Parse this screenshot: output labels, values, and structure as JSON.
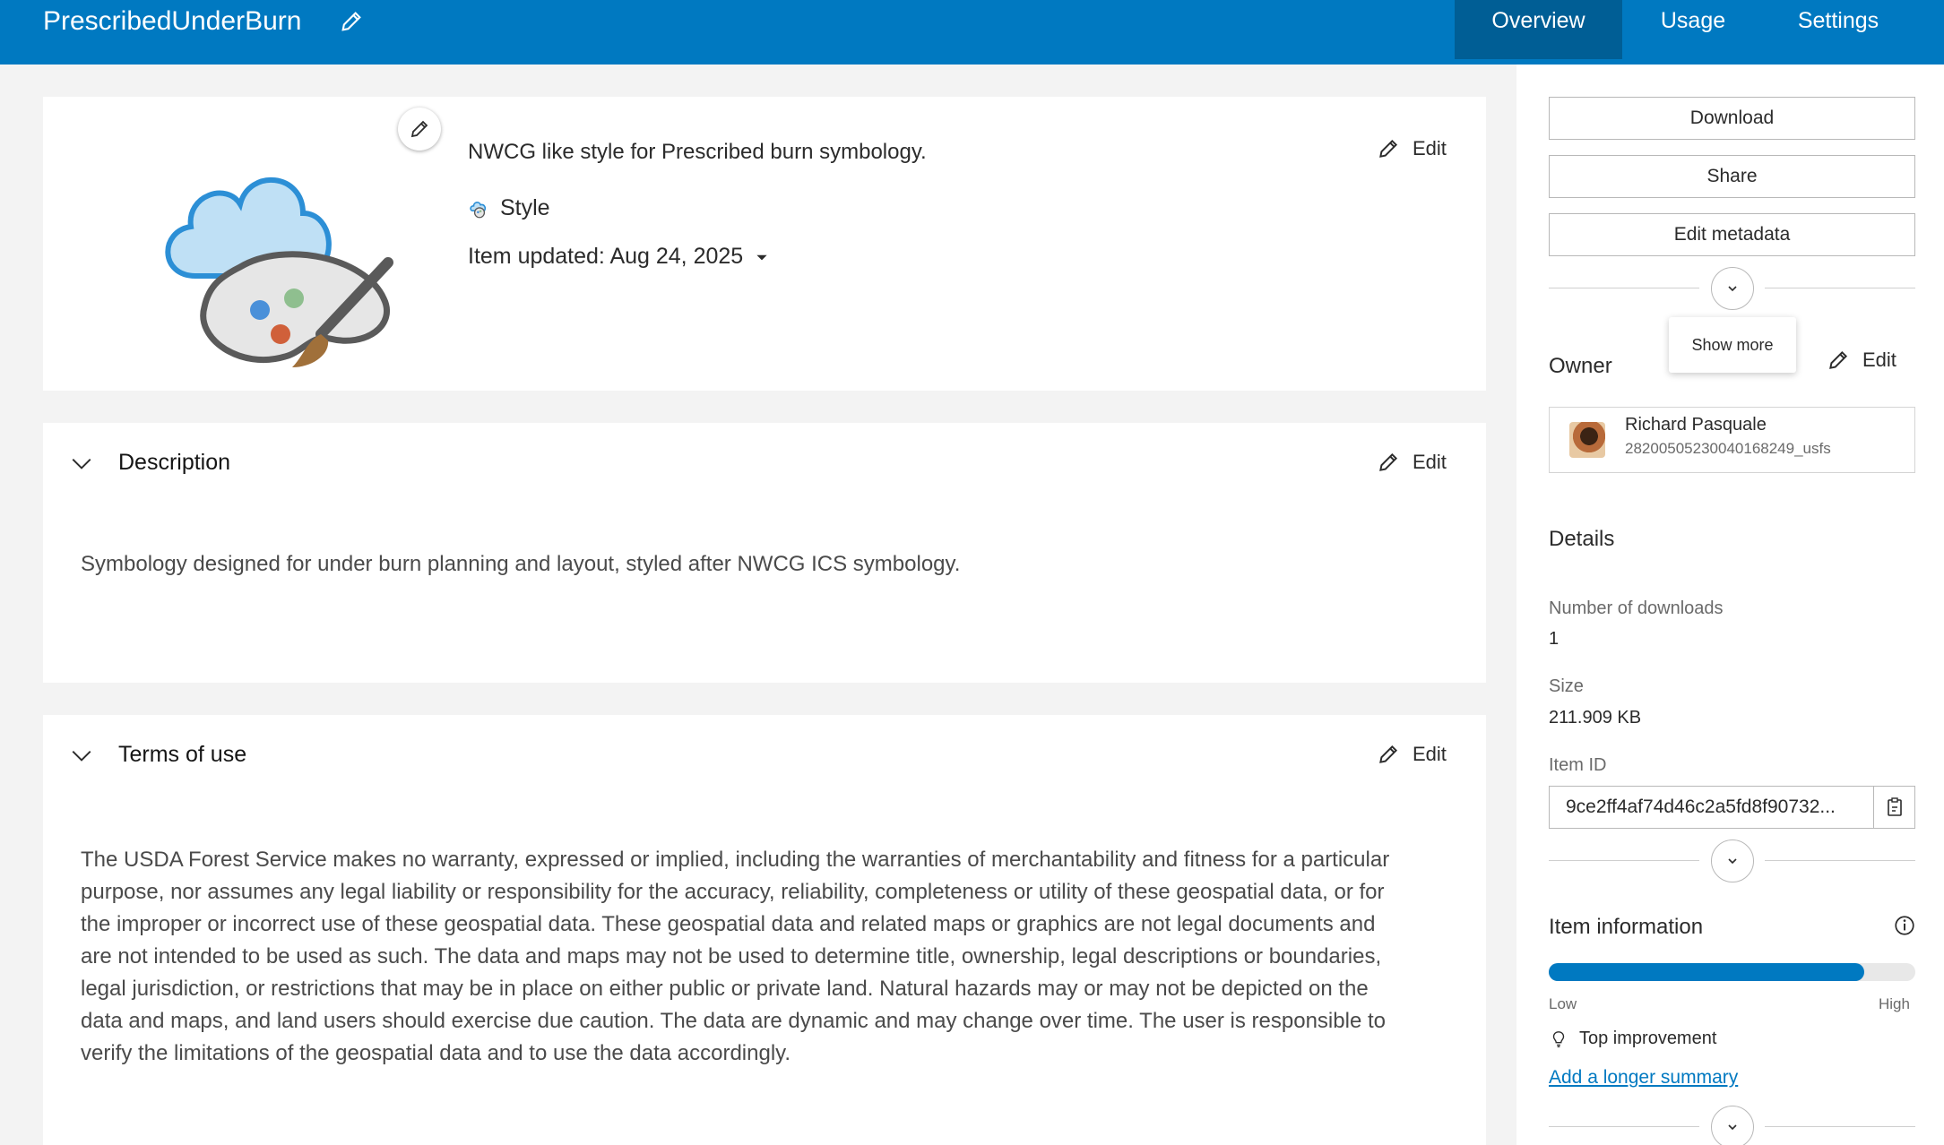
{
  "header": {
    "title": "PrescribedUnderBurn",
    "tabs": [
      {
        "label": "Overview",
        "active": true
      },
      {
        "label": "Usage",
        "active": false
      },
      {
        "label": "Settings",
        "active": false
      }
    ]
  },
  "summary": {
    "text": "NWCG like style for Prescribed burn symbology.",
    "type_label": "Style",
    "updated_text": "Item updated: Aug 24, 2025",
    "edit_label": "Edit"
  },
  "description": {
    "heading": "Description",
    "edit_label": "Edit",
    "body": "Symbology designed for under burn planning and layout, styled after NWCG ICS symbology."
  },
  "terms": {
    "heading": "Terms of use",
    "edit_label": "Edit",
    "lines": [
      "The USDA Forest Service makes no warranty, expressed or implied, including the warranties of merchantability and fitness for a particular",
      "purpose, nor assumes any legal liability or responsibility for the accuracy, reliability, completeness or utility of these geospatial data, or for",
      "the improper or incorrect use of these geospatial data. These geospatial data and related maps or graphics are not legal documents and",
      "are not intended to be used as such. The data and maps may not be used to determine title, ownership, legal descriptions or boundaries,",
      "legal jurisdiction, or restrictions that may be in place on either public or private land. Natural hazards may or may not be depicted on the",
      "data and maps, and land users should exercise due caution. The data are dynamic and may change over time. The user is responsible to",
      "verify the limitations of the geospatial data and to use the data accordingly."
    ]
  },
  "sidebar": {
    "buttons": [
      "Download",
      "Share",
      "Edit metadata"
    ],
    "show_more_tooltip": "Show more",
    "owner": {
      "heading": "Owner",
      "edit_label": "Edit",
      "name": "Richard Pasquale",
      "username": "28200505230040168249_usfs"
    },
    "details": {
      "heading": "Details",
      "downloads_label": "Number of downloads",
      "downloads_value": "1",
      "size_label": "Size",
      "size_value": "211.909 KB",
      "item_id_label": "Item ID",
      "item_id_value": "9ce2ff4af74d46c2a5fd8f90732..."
    },
    "item_information": {
      "heading": "Item information",
      "progress": 0.86,
      "low_label": "Low",
      "high_label": "High",
      "top_improvement_label": "Top improvement",
      "link_label": "Add a longer summary"
    }
  },
  "colors": {
    "brand": "#0079c1",
    "brand_dark": "#005e95"
  }
}
